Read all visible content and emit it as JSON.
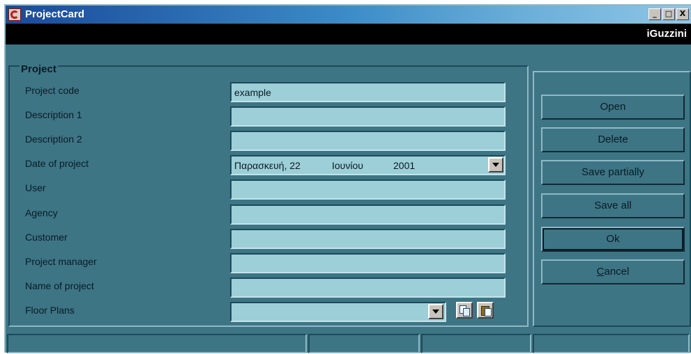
{
  "window": {
    "title": "ProjectCard",
    "controls": [
      "_",
      "□",
      "X"
    ]
  },
  "brand": "iGuzzini",
  "panel": {
    "legend": "Project",
    "fields": [
      {
        "label": "Project code",
        "value": "example"
      },
      {
        "label": "Description 1",
        "value": ""
      },
      {
        "label": "Description 2",
        "value": ""
      },
      {
        "label": "Date of project",
        "value": ""
      },
      {
        "label": "User",
        "value": ""
      },
      {
        "label": "Agency",
        "value": ""
      },
      {
        "label": "Customer",
        "value": ""
      },
      {
        "label": "Project manager",
        "value": ""
      },
      {
        "label": "Name of project",
        "value": ""
      },
      {
        "label": "Floor Plans",
        "value": ""
      }
    ],
    "date": {
      "day": "Παρασκευή, 22",
      "month": "Ιουνίου",
      "year": "2001"
    }
  },
  "actions": {
    "open": "Open",
    "delete": "Delete",
    "save_partially": "Save partially",
    "save_all": "Save all",
    "ok": "Ok",
    "cancel_accel": "C",
    "cancel_rest": "ancel"
  },
  "icons": {
    "app": "app-logo-icon",
    "copy": "copy-icon",
    "paste": "paste-icon",
    "dropdown": "chevron-down-icon"
  },
  "colors": {
    "background": "#3d7585",
    "field": "#9ccfd8",
    "brandbar": "#000000"
  }
}
